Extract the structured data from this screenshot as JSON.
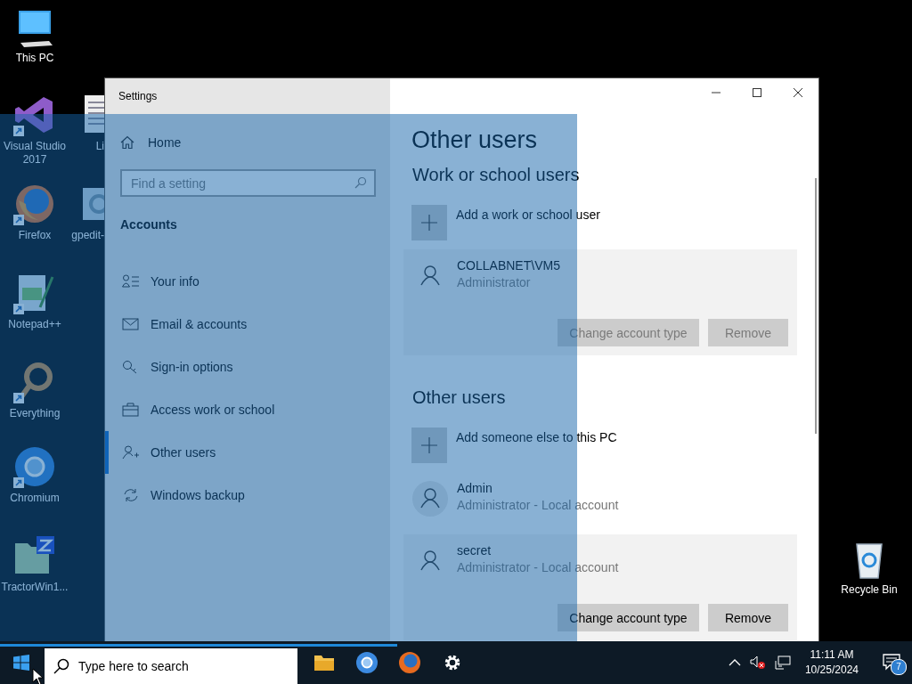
{
  "desktop_icons": [
    {
      "label": "This PC",
      "kind": "pc",
      "shortcut": false
    },
    {
      "label": "Visual Studio 2017",
      "kind": "vs",
      "shortcut": true
    },
    {
      "label": "Li",
      "kind": "doc",
      "shortcut": false
    },
    {
      "label": "Firefox",
      "kind": "firefox",
      "shortcut": true
    },
    {
      "label": "gpedit-",
      "kind": "gpedit",
      "shortcut": false
    },
    {
      "label": "Notepad++",
      "kind": "notepad",
      "shortcut": true
    },
    {
      "label": "Everything",
      "kind": "everything",
      "shortcut": true
    },
    {
      "label": "Chromium",
      "kind": "chromium",
      "shortcut": true
    },
    {
      "label": "TractorWin1...",
      "kind": "tractor",
      "shortcut": false
    },
    {
      "label": "Recycle Bin",
      "kind": "recycle",
      "shortcut": false
    }
  ],
  "window": {
    "title": "Settings",
    "sidebar": {
      "home": "Home",
      "search": {
        "placeholder": "Find a setting"
      },
      "section": "Accounts",
      "items": [
        {
          "label": "Your info",
          "kind": "info",
          "selected": false
        },
        {
          "label": "Email & accounts",
          "kind": "mail",
          "selected": false
        },
        {
          "label": "Sign-in options",
          "kind": "key",
          "selected": false
        },
        {
          "label": "Access work or school",
          "kind": "briefcase",
          "selected": false
        },
        {
          "label": "Other users",
          "kind": "users",
          "selected": true
        },
        {
          "label": "Windows backup",
          "kind": "sync",
          "selected": false
        }
      ]
    },
    "content": {
      "title": "Other users",
      "sections": [
        {
          "heading": "Work or school users",
          "add": "Add a work or school user",
          "users": [
            {
              "name": "COLLABNET\\VM5",
              "role": "Administrator",
              "expanded": true,
              "buttons": [
                {
                  "label": "Change account type",
                  "disabled": true
                },
                {
                  "label": "Remove",
                  "disabled": true
                }
              ]
            }
          ]
        },
        {
          "heading": "Other users",
          "add": "Add someone else to this PC",
          "users": [
            {
              "name": "Admin",
              "role": "Administrator - Local account",
              "expanded": false
            },
            {
              "name": "secret",
              "role": "Administrator - Local account",
              "expanded": true,
              "buttons": [
                {
                  "label": "Change account type",
                  "disabled": false
                },
                {
                  "label": "Remove",
                  "disabled": false
                }
              ]
            }
          ]
        }
      ]
    }
  },
  "taskbar": {
    "search": {
      "placeholder": "Type here to search"
    },
    "apps": [
      {
        "kind": "explorer"
      },
      {
        "kind": "chromium"
      },
      {
        "kind": "firefox"
      },
      {
        "kind": "settings"
      }
    ],
    "time": "11:11 AM",
    "date": "10/25/2024",
    "notifications": "7"
  }
}
